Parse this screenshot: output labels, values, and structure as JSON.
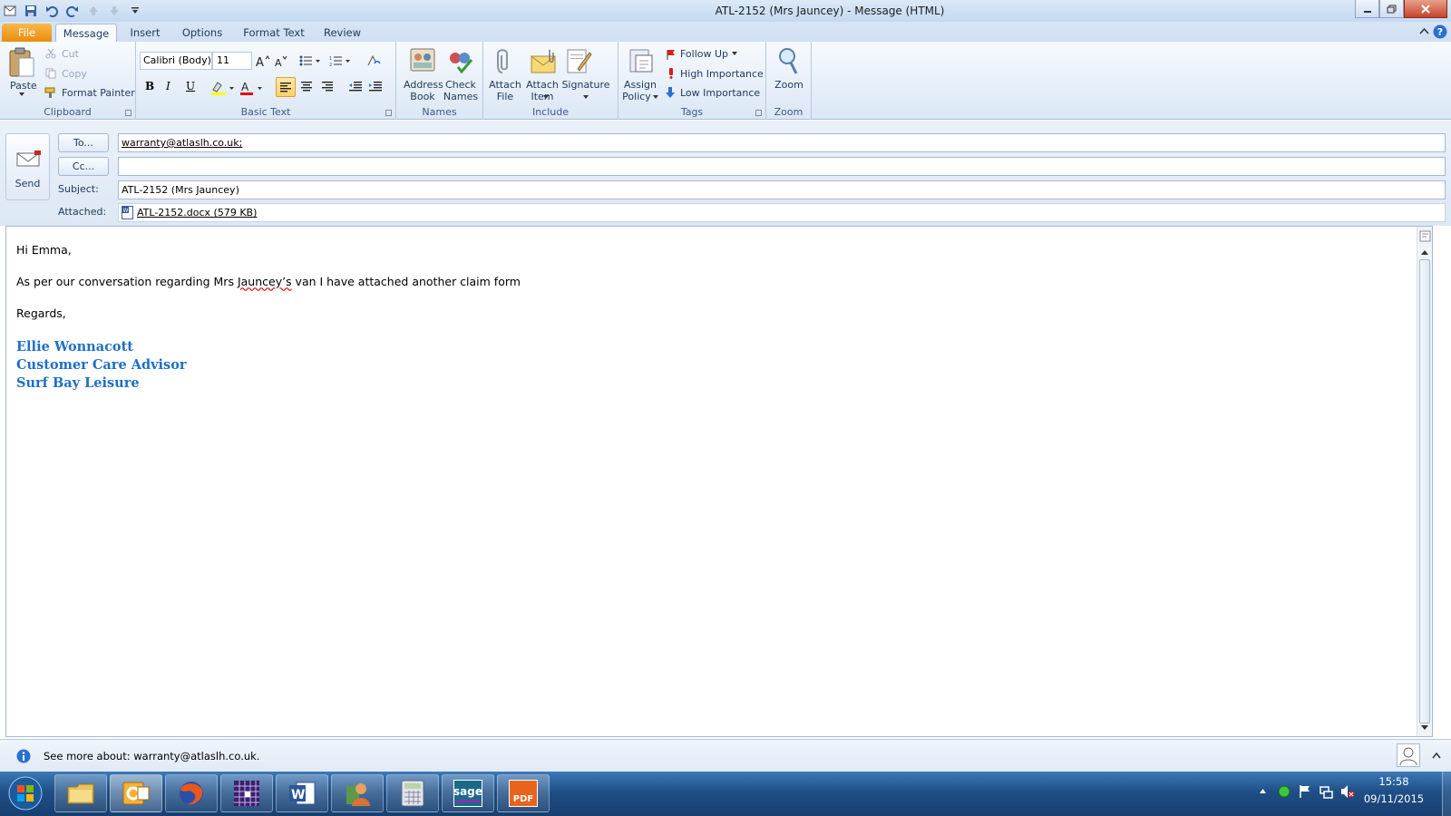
{
  "window": {
    "title": "ATL-2152 (Mrs Jauncey)  -  Message (HTML)"
  },
  "tabs": [
    {
      "label": "File"
    },
    {
      "label": "Message"
    },
    {
      "label": "Insert"
    },
    {
      "label": "Options"
    },
    {
      "label": "Format Text"
    },
    {
      "label": "Review"
    }
  ],
  "ribbon": {
    "clipboard": {
      "label": "Clipboard",
      "paste": "Paste",
      "cut": "Cut",
      "copy": "Copy",
      "format_painter": "Format Painter"
    },
    "basic_text": {
      "label": "Basic Text",
      "font_name": "Calibri (Body)",
      "font_size": "11",
      "bold": "B",
      "italic": "I",
      "underline": "U"
    },
    "names": {
      "label": "Names",
      "address_book_1": "Address",
      "address_book_2": "Book",
      "check_names_1": "Check",
      "check_names_2": "Names"
    },
    "include": {
      "label": "Include",
      "attach_file_1": "Attach",
      "attach_file_2": "File",
      "attach_item_1": "Attach",
      "attach_item_2": "Item",
      "signature": "Signature"
    },
    "tags": {
      "label": "Tags",
      "assign_policy_1": "Assign",
      "assign_policy_2": "Policy",
      "follow_up": "Follow Up",
      "high_importance": "High Importance",
      "low_importance": "Low Importance"
    },
    "zoom": {
      "label": "Zoom",
      "zoom": "Zoom"
    }
  },
  "compose": {
    "send_label": "Send",
    "to_button": "To...",
    "cc_button": "Cc...",
    "to_value": "warranty@atlaslh.co.uk;",
    "cc_value": "",
    "subject_label": "Subject:",
    "subject_value": "ATL-2152 (Mrs Jauncey)",
    "attached_label": "Attached:",
    "attachment": "ATL-2152.docx (579 KB)"
  },
  "message": {
    "greeting": "Hi Emma,",
    "line1_pre": "As per our conversation regarding Mrs ",
    "line1_misspelled": "Jauncey’s",
    "line1_post": " van I have attached another claim form",
    "closing": "Regards,",
    "signature": [
      "Ellie Wonnacott",
      "Customer Care Advisor",
      "Surf Bay Leisure"
    ]
  },
  "people_pane": {
    "text": "See more about: warranty@atlaslh.co.uk."
  },
  "taskbar": {
    "apps": [
      "start-orb",
      "file-explorer",
      "outlook",
      "firefox",
      "grid-app",
      "word",
      "contacts-app",
      "calculator",
      "sage",
      "pdf-app"
    ],
    "sage_label": "sage",
    "pdf_label": "PDF",
    "time": "15:58",
    "date": "09/11/2015"
  },
  "colors": {
    "signature_blue": "#1f6fc5",
    "file_tab": "#e88b0b",
    "ribbon_bg": "#dbe7f5"
  }
}
